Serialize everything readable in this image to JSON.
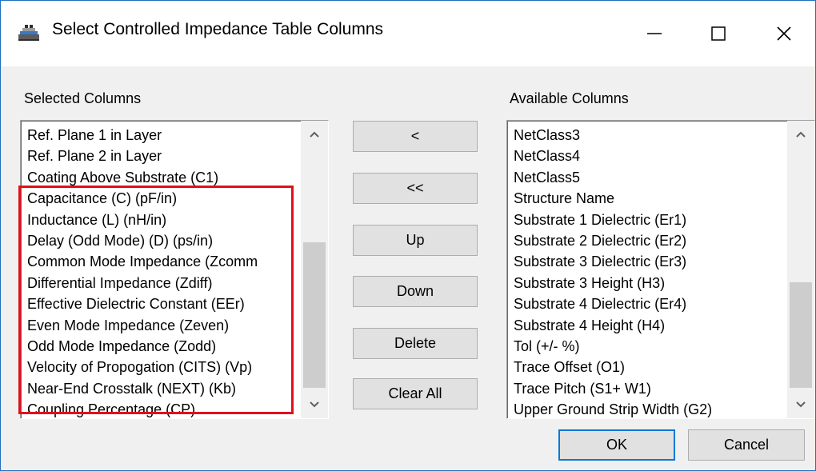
{
  "window": {
    "title": "Select Controlled Impedance Table Columns",
    "icons": {
      "app": "app-icon",
      "minimize": "minimize-icon",
      "maximize": "maximize-icon",
      "close": "close-icon"
    }
  },
  "selected": {
    "label": "Selected Columns",
    "items": [
      "Ref. Plane 1 in Layer",
      "Ref. Plane 2 in Layer",
      "Coating Above Substrate (C1)",
      "Capacitance (C) (pF/in)",
      "Inductance (L) (nH/in)",
      "Delay (Odd Mode) (D) (ps/in)",
      "Common Mode Impedance (Zcomm",
      "Differential Impedance (Zdiff)",
      "Effective Dielectric Constant (EEr)",
      "Even Mode Impedance (Zeven)",
      "Odd Mode Impedance (Zodd)",
      "Velocity of Propogation (CITS) (Vp)",
      "Near-End Crosstalk (NEXT) (Kb)",
      "Coupling Percentage (CP)"
    ],
    "highlight_color": "#e0101c"
  },
  "available": {
    "label": "Available Columns",
    "items": [
      "NetClass3",
      "NetClass4",
      "NetClass5",
      "Structure Name",
      "Substrate 1 Dielectric (Er1)",
      "Substrate 2 Dielectric (Er2)",
      "Substrate 3 Dielectric (Er3)",
      "Substrate 3 Height (H3)",
      "Substrate 4 Dielectric (Er4)",
      "Substrate 4 Height (H4)",
      "Tol (+/- %)",
      "Trace Offset (O1)",
      "Trace Pitch (S1+ W1)",
      "Upper Ground Strip Width (G2)"
    ]
  },
  "buttons": {
    "move_left": "<",
    "move_all_left": "<<",
    "up": "Up",
    "down": "Down",
    "delete": "Delete",
    "clear_all": "Clear All",
    "ok": "OK",
    "cancel": "Cancel"
  },
  "colors": {
    "accent": "#0078d7",
    "dialog_bg": "#f0f0f0"
  }
}
